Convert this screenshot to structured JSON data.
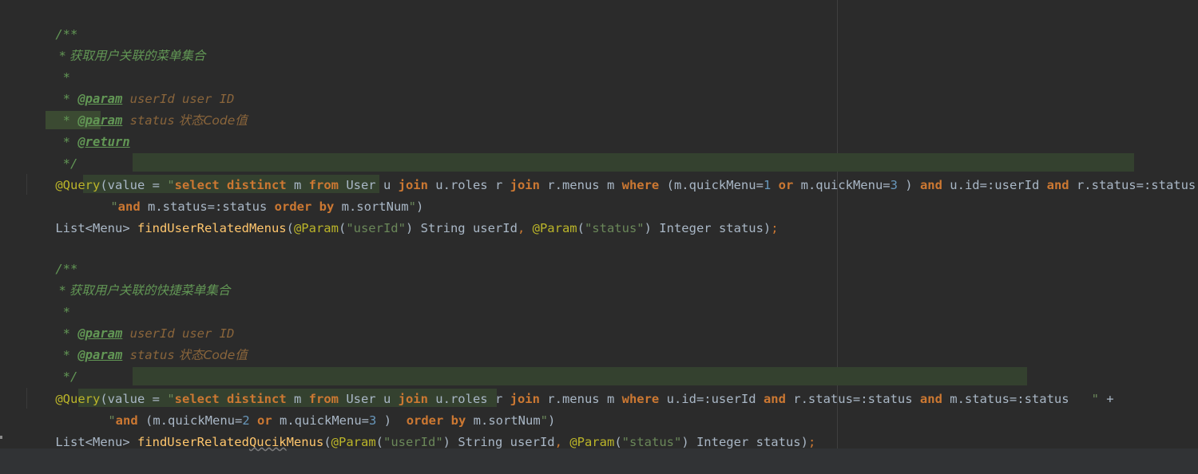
{
  "editor": {
    "block1": {
      "doc_open": "/**",
      "doc_desc": " * 获取用户关联的菜单集合",
      "doc_blank": " *",
      "doc_param1_star": " * ",
      "doc_param1_tag": "@param",
      "doc_param1_name": " userId",
      "doc_param1_desc": " user ID",
      "doc_param2_star": " * ",
      "doc_param2_tag": "@param",
      "doc_param2_name": " status",
      "doc_param2_desc": " 状态Code值",
      "doc_return_star": " * ",
      "doc_return_tag": "@return",
      "doc_close": " */",
      "query_ann": "@Query",
      "query_open": "(value = ",
      "q1": "\"",
      "q1_kw1": "select distinct",
      "q1_t1": " m ",
      "q1_kw2": "from",
      "q1_t2": " User u ",
      "q1_kw3": "join",
      "q1_t3": " u.roles r ",
      "q1_kw4": "join",
      "q1_t4": " r.menus m ",
      "q1_kw5": "where",
      "q1_t5": " (m.quickMenu=",
      "q1_n1": "1",
      "q1_t6": " ",
      "q1_kw6": "or",
      "q1_t7": " m.quickMenu=",
      "q1_n2": "3",
      "q1_t8": " ) ",
      "q1_kw7": "and",
      "q1_t9": " u.id=:userId ",
      "q1_kw8": "and",
      "q1_t10": " r.status=:status ",
      "q1_end": "\"",
      "q1_plus": " +",
      "q2": "\"",
      "q2_kw1": "and",
      "q2_t1": " m.status=:status ",
      "q2_kw2": "order by",
      "q2_t2": " m.sortNum",
      "q2_end": "\"",
      "q2_close": ")",
      "sig_type": "List<Menu> ",
      "sig_fn": "findUserRelatedMenus",
      "sig_p1_open": "(",
      "sig_p1_ann": "@Param",
      "sig_p1_lp": "(",
      "sig_p1_str": "\"userId\"",
      "sig_p1_rest": ") String userId",
      "sig_comma": ", ",
      "sig_p2_ann": "@Param",
      "sig_p2_lp": "(",
      "sig_p2_str": "\"status\"",
      "sig_p2_rest": ") Integer status)",
      "sig_semi": ";"
    },
    "block2": {
      "doc_open": "/**",
      "doc_desc": " * 获取用户关联的快捷菜单集合",
      "doc_blank": " *",
      "doc_param1_star": " * ",
      "doc_param1_tag": "@param",
      "doc_param1_name": " userId",
      "doc_param1_desc": " user ID",
      "doc_param2_star": " * ",
      "doc_param2_tag": "@param",
      "doc_param2_name": " status",
      "doc_param2_desc": " 状态Code值",
      "doc_close": " */",
      "query_ann": "@Query",
      "query_open": "(value = ",
      "q1": "\"",
      "q1_kw1": "select distinct",
      "q1_t1": " m ",
      "q1_kw2": "from",
      "q1_t2": " User u ",
      "q1_kw3": "join",
      "q1_t3": " u.roles r ",
      "q1_kw4": "join",
      "q1_t4": " r.menus m ",
      "q1_kw5": "where",
      "q1_t5": " u.id=:userId ",
      "q1_kw6": "and",
      "q1_t6": " r.status=:status ",
      "q1_kw7": "and",
      "q1_t7": " m.status=:status   ",
      "q1_end": "\"",
      "q1_plus": " +",
      "q2": "\"",
      "q2_kw1": "and",
      "q2_t1": " (m.quickMenu=",
      "q2_n1": "2",
      "q2_t2": " ",
      "q2_kw2": "or",
      "q2_t3": " m.quickMenu=",
      "q2_n2": "3",
      "q2_t4": " )  ",
      "q2_kw3": "order by",
      "q2_t5": " m.sortNum",
      "q2_end": "\"",
      "q2_close": ")",
      "sig_type": "List<Menu> ",
      "sig_fn_a": "findUserRelated",
      "sig_fn_typo": "Qucik",
      "sig_fn_b": "Menus",
      "sig_p1_open": "(",
      "sig_p1_ann": "@Param",
      "sig_p1_lp": "(",
      "sig_p1_str": "\"userId\"",
      "sig_p1_rest": ") String userId",
      "sig_comma": ", ",
      "sig_p2_ann": "@Param",
      "sig_p2_lp": "(",
      "sig_p2_str": "\"status\"",
      "sig_p2_rest": ") Integer status)",
      "sig_semi": ";"
    }
  },
  "colors": {
    "background": "#2b2b2b",
    "doc_comment": "#629755",
    "keyword": "#cc7832",
    "annotation": "#bbb529",
    "string": "#6a8759",
    "number": "#6897bb",
    "method": "#ffc66d",
    "text": "#a9b7c6",
    "injected_sql_bg": "#34412f"
  }
}
